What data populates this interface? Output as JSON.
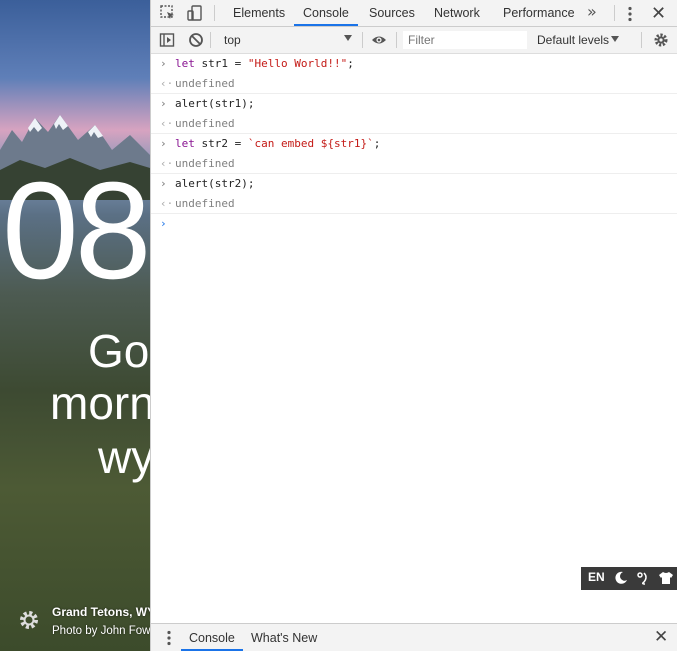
{
  "background_page": {
    "clock": "08",
    "greeting_lines": [
      "Go",
      "morn",
      "wy"
    ],
    "caption_location": "Grand Tetons, WY",
    "caption_photo": "Photo by John Fow"
  },
  "devtools": {
    "tabs": [
      "Elements",
      "Console",
      "Sources",
      "Network",
      "Performance"
    ],
    "active_tab": "Console",
    "more_tabs": "»",
    "close": "✕",
    "toolbar": {
      "context": "top",
      "filter_placeholder": "Filter",
      "levels": "Default levels"
    },
    "console_lines": [
      {
        "kind": "input",
        "parts": [
          [
            "kw",
            "let"
          ],
          [
            "plain",
            " str1 = "
          ],
          [
            "str",
            "\"Hello World!!\""
          ],
          [
            "plain",
            ";"
          ]
        ]
      },
      {
        "kind": "output",
        "text": "undefined"
      },
      {
        "kind": "input",
        "parts": [
          [
            "plain",
            "alert(str1);"
          ]
        ]
      },
      {
        "kind": "output",
        "text": "undefined"
      },
      {
        "kind": "input",
        "parts": [
          [
            "kw",
            "let"
          ],
          [
            "plain",
            " str2 = "
          ],
          [
            "str",
            "`can embed ${str1}`"
          ],
          [
            "plain",
            ";"
          ]
        ]
      },
      {
        "kind": "output",
        "text": "undefined"
      },
      {
        "kind": "input",
        "parts": [
          [
            "plain",
            "alert(str2);"
          ]
        ]
      },
      {
        "kind": "output",
        "text": "undefined"
      }
    ],
    "input_chevron": "›",
    "output_chevron": "‹·",
    "widget": {
      "lang": "EN"
    },
    "drawer": {
      "tabs": [
        "Console",
        "What's New"
      ],
      "active_tab": "Console",
      "close": "✕"
    }
  },
  "colors": {
    "accent": "#1a73e8",
    "keyword": "#881391",
    "string": "#c41a16"
  }
}
